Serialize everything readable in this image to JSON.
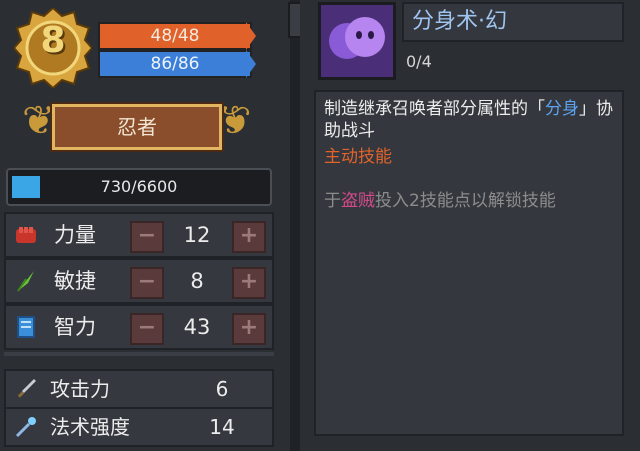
{
  "player": {
    "level": "8",
    "hp": "48/48",
    "mp": "86/86",
    "class_name": "忍者",
    "xp_text": "730/6600",
    "xp_progress": 0.11
  },
  "stats": [
    {
      "name": "力量",
      "value": "12",
      "icon": "strength-fist-icon"
    },
    {
      "name": "敏捷",
      "value": "8",
      "icon": "agility-feather-icon"
    },
    {
      "name": "智力",
      "value": "43",
      "icon": "intelligence-book-icon"
    }
  ],
  "derived": [
    {
      "name": "攻击力",
      "value": "6",
      "icon": "sword-icon"
    },
    {
      "name": "法术强度",
      "value": "14",
      "icon": "wand-icon"
    }
  ],
  "skill": {
    "name": "分身术·幻",
    "points": "0/4",
    "desc_part1": "制造继承召唤者部分属性的「",
    "desc_highlight": "分身",
    "desc_part2": "」协助战斗",
    "type": "主动技能",
    "req_prefix": "于",
    "req_class": "盗贼",
    "req_suffix": "投入2技能点以解锁技能"
  },
  "colors": {
    "hp": "#e0622a",
    "mp": "#3b7fd8",
    "xp": "#3aa6e6",
    "skill_name": "#9fc4ef",
    "active_skill": "#e2622a",
    "class_highlight": "#d24a8a"
  }
}
